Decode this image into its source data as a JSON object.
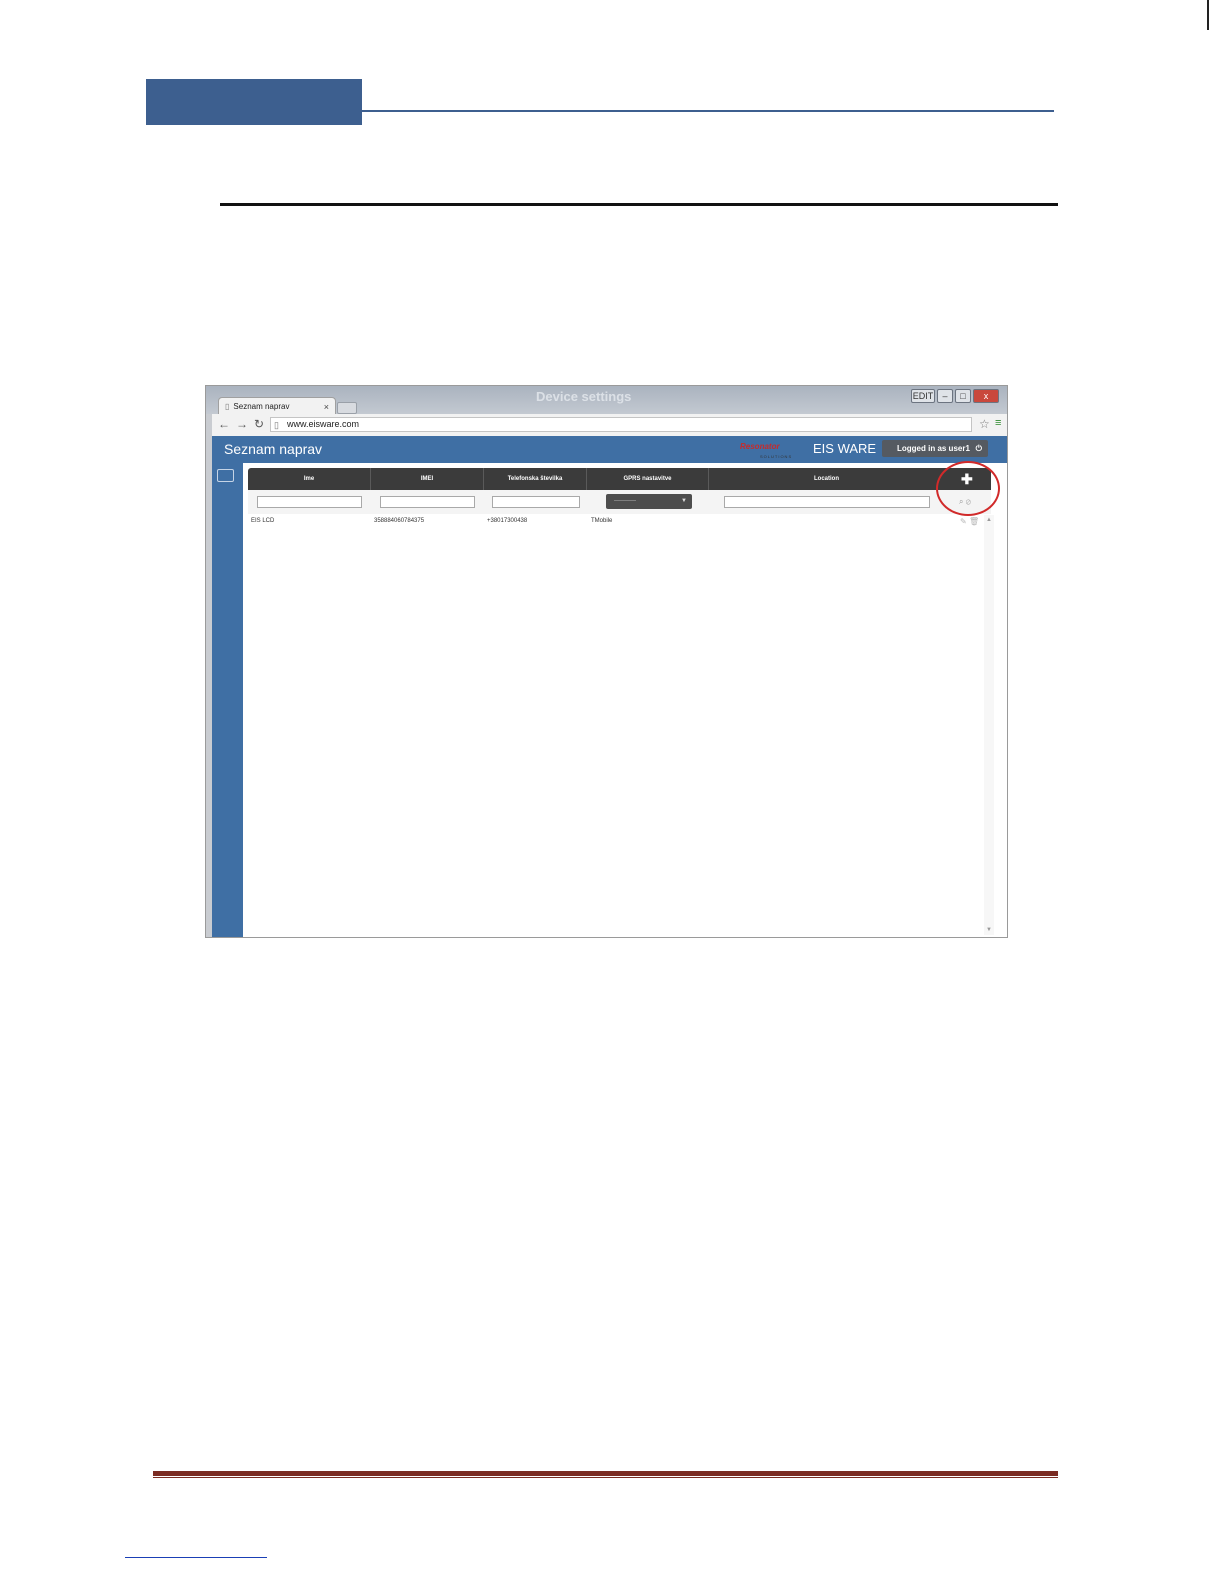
{
  "browser": {
    "tab_title": "Seznam naprav",
    "tab_close": "×",
    "url": "www.eisware.com",
    "background_window_title": "Device settings",
    "win_user_label": "EDIT",
    "win_min": "–",
    "win_max": "□",
    "win_close": "x"
  },
  "app": {
    "title": "Seznam naprav",
    "logo_text": "Resonator",
    "logo_sub": "SOLUTIONS",
    "brand": "EIS WARE",
    "logged_in": "Logged in as user1"
  },
  "grid": {
    "columns": [
      "Ime",
      "IMEI",
      "Telefonska številka",
      "GPRS nastavitve",
      "Location"
    ],
    "add_button": "✚",
    "select_placeholder": "-----------",
    "rows": [
      {
        "ime": "EIS LCD",
        "imei": "358884060784375",
        "phone": "+38017300438",
        "gprs": "TMobile",
        "location": ""
      }
    ]
  },
  "colors": {
    "doc_accent": "#3d5f8f",
    "footer_rule": "#7b2b22",
    "app_header": "#3f6fa4",
    "highlight_circle": "#d12a2a"
  }
}
